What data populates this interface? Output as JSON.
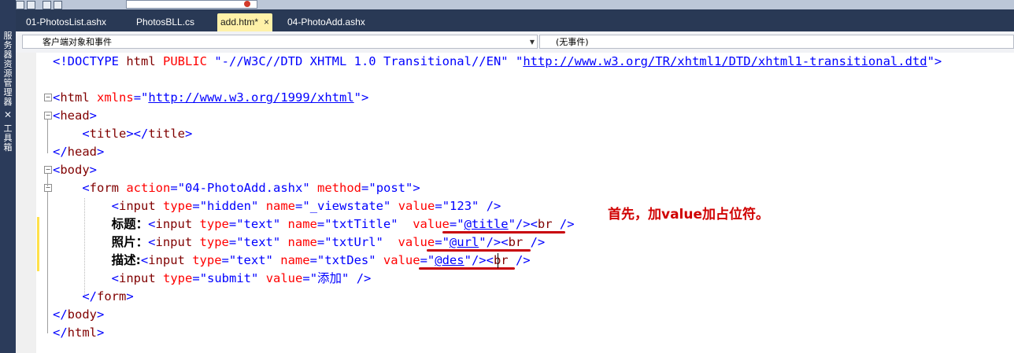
{
  "side_tabs": {
    "server_explorer": "服务器资源管理器",
    "toolbox": "工具箱"
  },
  "tabs": [
    {
      "label": "01-PhotosList.ashx"
    },
    {
      "label": "PhotosBLL.cs"
    },
    {
      "label": "add.htm*",
      "active": true,
      "close": "×"
    },
    {
      "label": "04-PhotoAdd.ashx"
    }
  ],
  "combos": {
    "client_objects": "客户端对象和事件",
    "events": "(无事件)"
  },
  "code": {
    "doctype": {
      "open": "<!DOCTYPE ",
      "html": "html",
      "public": "PUBLIC",
      "q1": "\"-//W3C//DTD XHTML 1.0 Transitional//EN\"",
      "q2_open": "\"",
      "url": "http://www.w3.org/TR/xhtml1/DTD/xhtml1-transitional.dtd",
      "q2_close": "\"",
      "close": ">"
    },
    "html_open": {
      "lt": "<",
      "tag": "html",
      "attr": "xmlns",
      "eq": "=\"",
      "url": "http://www.w3.org/1999/xhtml",
      "end": "\">"
    },
    "head_open": {
      "lt": "<",
      "tag": "head",
      "gt": ">"
    },
    "title": {
      "lt1": "<",
      "tag1": "title",
      "mid": "></",
      "tag2": "title",
      "gt": ">"
    },
    "head_close": {
      "lt": "</",
      "tag": "head",
      "gt": ">"
    },
    "body_open": {
      "lt": "<",
      "tag": "body",
      "gt": ">"
    },
    "form": {
      "lt": "<",
      "tag": "form",
      "a1": "action",
      "v1": "\"04-PhotoAdd.ashx\"",
      "a2": "method",
      "v2": "\"post\"",
      "gt": ">"
    },
    "hidden": {
      "lt": "<",
      "tag": "input",
      "a1": "type",
      "v1": "\"hidden\"",
      "a2": "name",
      "v2": "\"_viewstate\"",
      "a3": "value",
      "v3": "\"123\"",
      "end": " />"
    },
    "title_input": {
      "label": "标题：",
      "lt": "<",
      "tag": "input",
      "a1": "type",
      "v1": "\"text\"",
      "a2": "name",
      "v2": "\"txtTitle\"",
      "a3": "value",
      "v3_open": "\"",
      "v3": "@title",
      "v3_close": "\"",
      "br": "/><",
      "brtag": "br",
      "brend": " />"
    },
    "url_input": {
      "label": "照片：",
      "lt": "<",
      "tag": "input",
      "a1": "type",
      "v1": "\"text\"",
      "a2": "name",
      "v2": "\"txtUrl\"",
      "a3": "value",
      "v3_open": "\"",
      "v3": "@url",
      "v3_close": "\"",
      "br": "/><",
      "brtag": "br",
      "brend": " />"
    },
    "des_input": {
      "label": "描述:",
      "lt": "<",
      "tag": "input",
      "a1": "type",
      "v1": "\"text\"",
      "a2": "name",
      "v2": "\"txtDes\"",
      "a3": "value",
      "v3_open": "\"",
      "v3": "@des",
      "v3_close": "\"",
      "br": "/><",
      "brtag": "br",
      "brend": " />"
    },
    "submit": {
      "lt": "<",
      "tag": "input",
      "a1": "type",
      "v1": "\"submit\"",
      "a2": "value",
      "v2": "\"添加\"",
      "end": " />"
    },
    "form_close": {
      "lt": "</",
      "tag": "form",
      "gt": ">"
    },
    "body_close": {
      "lt": "</",
      "tag": "body",
      "gt": ">"
    },
    "html_close": {
      "lt": "</",
      "tag": "html",
      "gt": ">"
    }
  },
  "annotation": "首先，加value加占位符。",
  "colors": {
    "keyword": "#0000ff",
    "tag": "#800000",
    "attribute": "#ff0000",
    "annotation": "#d00000",
    "tab_active": "#fff1a8",
    "tab_strip": "#293955"
  }
}
